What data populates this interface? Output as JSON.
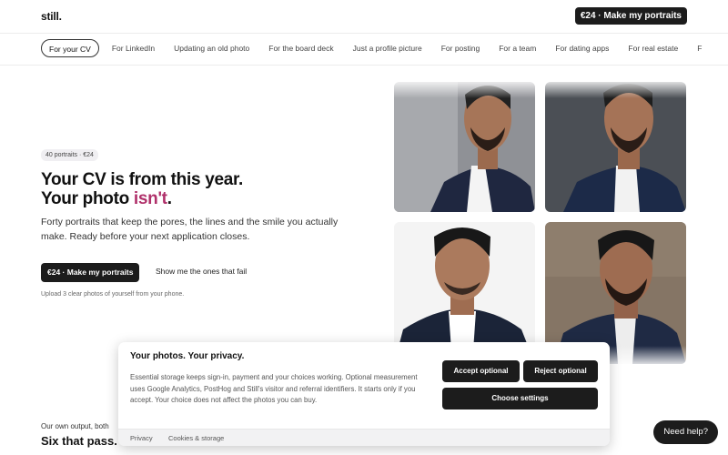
{
  "header": {
    "logo": "still.",
    "cta_label": "€24 · Make my portraits"
  },
  "tabs": [
    {
      "label": "For your CV",
      "active": true
    },
    {
      "label": "For LinkedIn",
      "active": false
    },
    {
      "label": "Updating an old photo",
      "active": false
    },
    {
      "label": "For the board deck",
      "active": false
    },
    {
      "label": "Just a profile picture",
      "active": false
    },
    {
      "label": "For posting",
      "active": false
    },
    {
      "label": "For a team",
      "active": false
    },
    {
      "label": "For dating apps",
      "active": false
    },
    {
      "label": "For real estate",
      "active": false
    },
    {
      "label": "F",
      "active": false
    }
  ],
  "hero": {
    "badge": "40 portraits · €24",
    "headline_part1": "Your CV is from this year. Your photo ",
    "headline_accent": "isn't",
    "headline_end": ".",
    "subhead": "Forty portraits that keep the pores, the lines and the smile you actually make. Ready before your next application closes.",
    "cta_primary": "€24 · Make my portraits",
    "cta_secondary": "Show me the ones that fail",
    "hint": "Upload 3 clear photos of yourself from your phone."
  },
  "portraits": [
    {
      "name": "portrait-gray-background",
      "background": "#8d8f93"
    },
    {
      "name": "portrait-dark-background",
      "background": "#4a4d52"
    },
    {
      "name": "portrait-white-background",
      "background": "#f3f3f3"
    },
    {
      "name": "portrait-textured-background",
      "background": "#8a7a6a"
    }
  ],
  "below_fold": {
    "kicker": "Our own output, both",
    "title": "Six that pass. S"
  },
  "cookie_banner": {
    "title": "Your photos. Your privacy.",
    "body": "Essential storage keeps sign-in, payment and your choices working. Optional measurement uses Google Analytics, PostHog and Still's visitor and referral identifiers. It starts only if you accept. Your choice does not affect the photos you can buy.",
    "accept_label": "Accept optional",
    "reject_label": "Reject optional",
    "settings_label": "Choose settings",
    "privacy_link": "Privacy",
    "cookies_link": "Cookies & storage"
  },
  "help_button": "Need help?",
  "colors": {
    "accent": "#b0306a",
    "dark_button": "#1c1c1c"
  }
}
